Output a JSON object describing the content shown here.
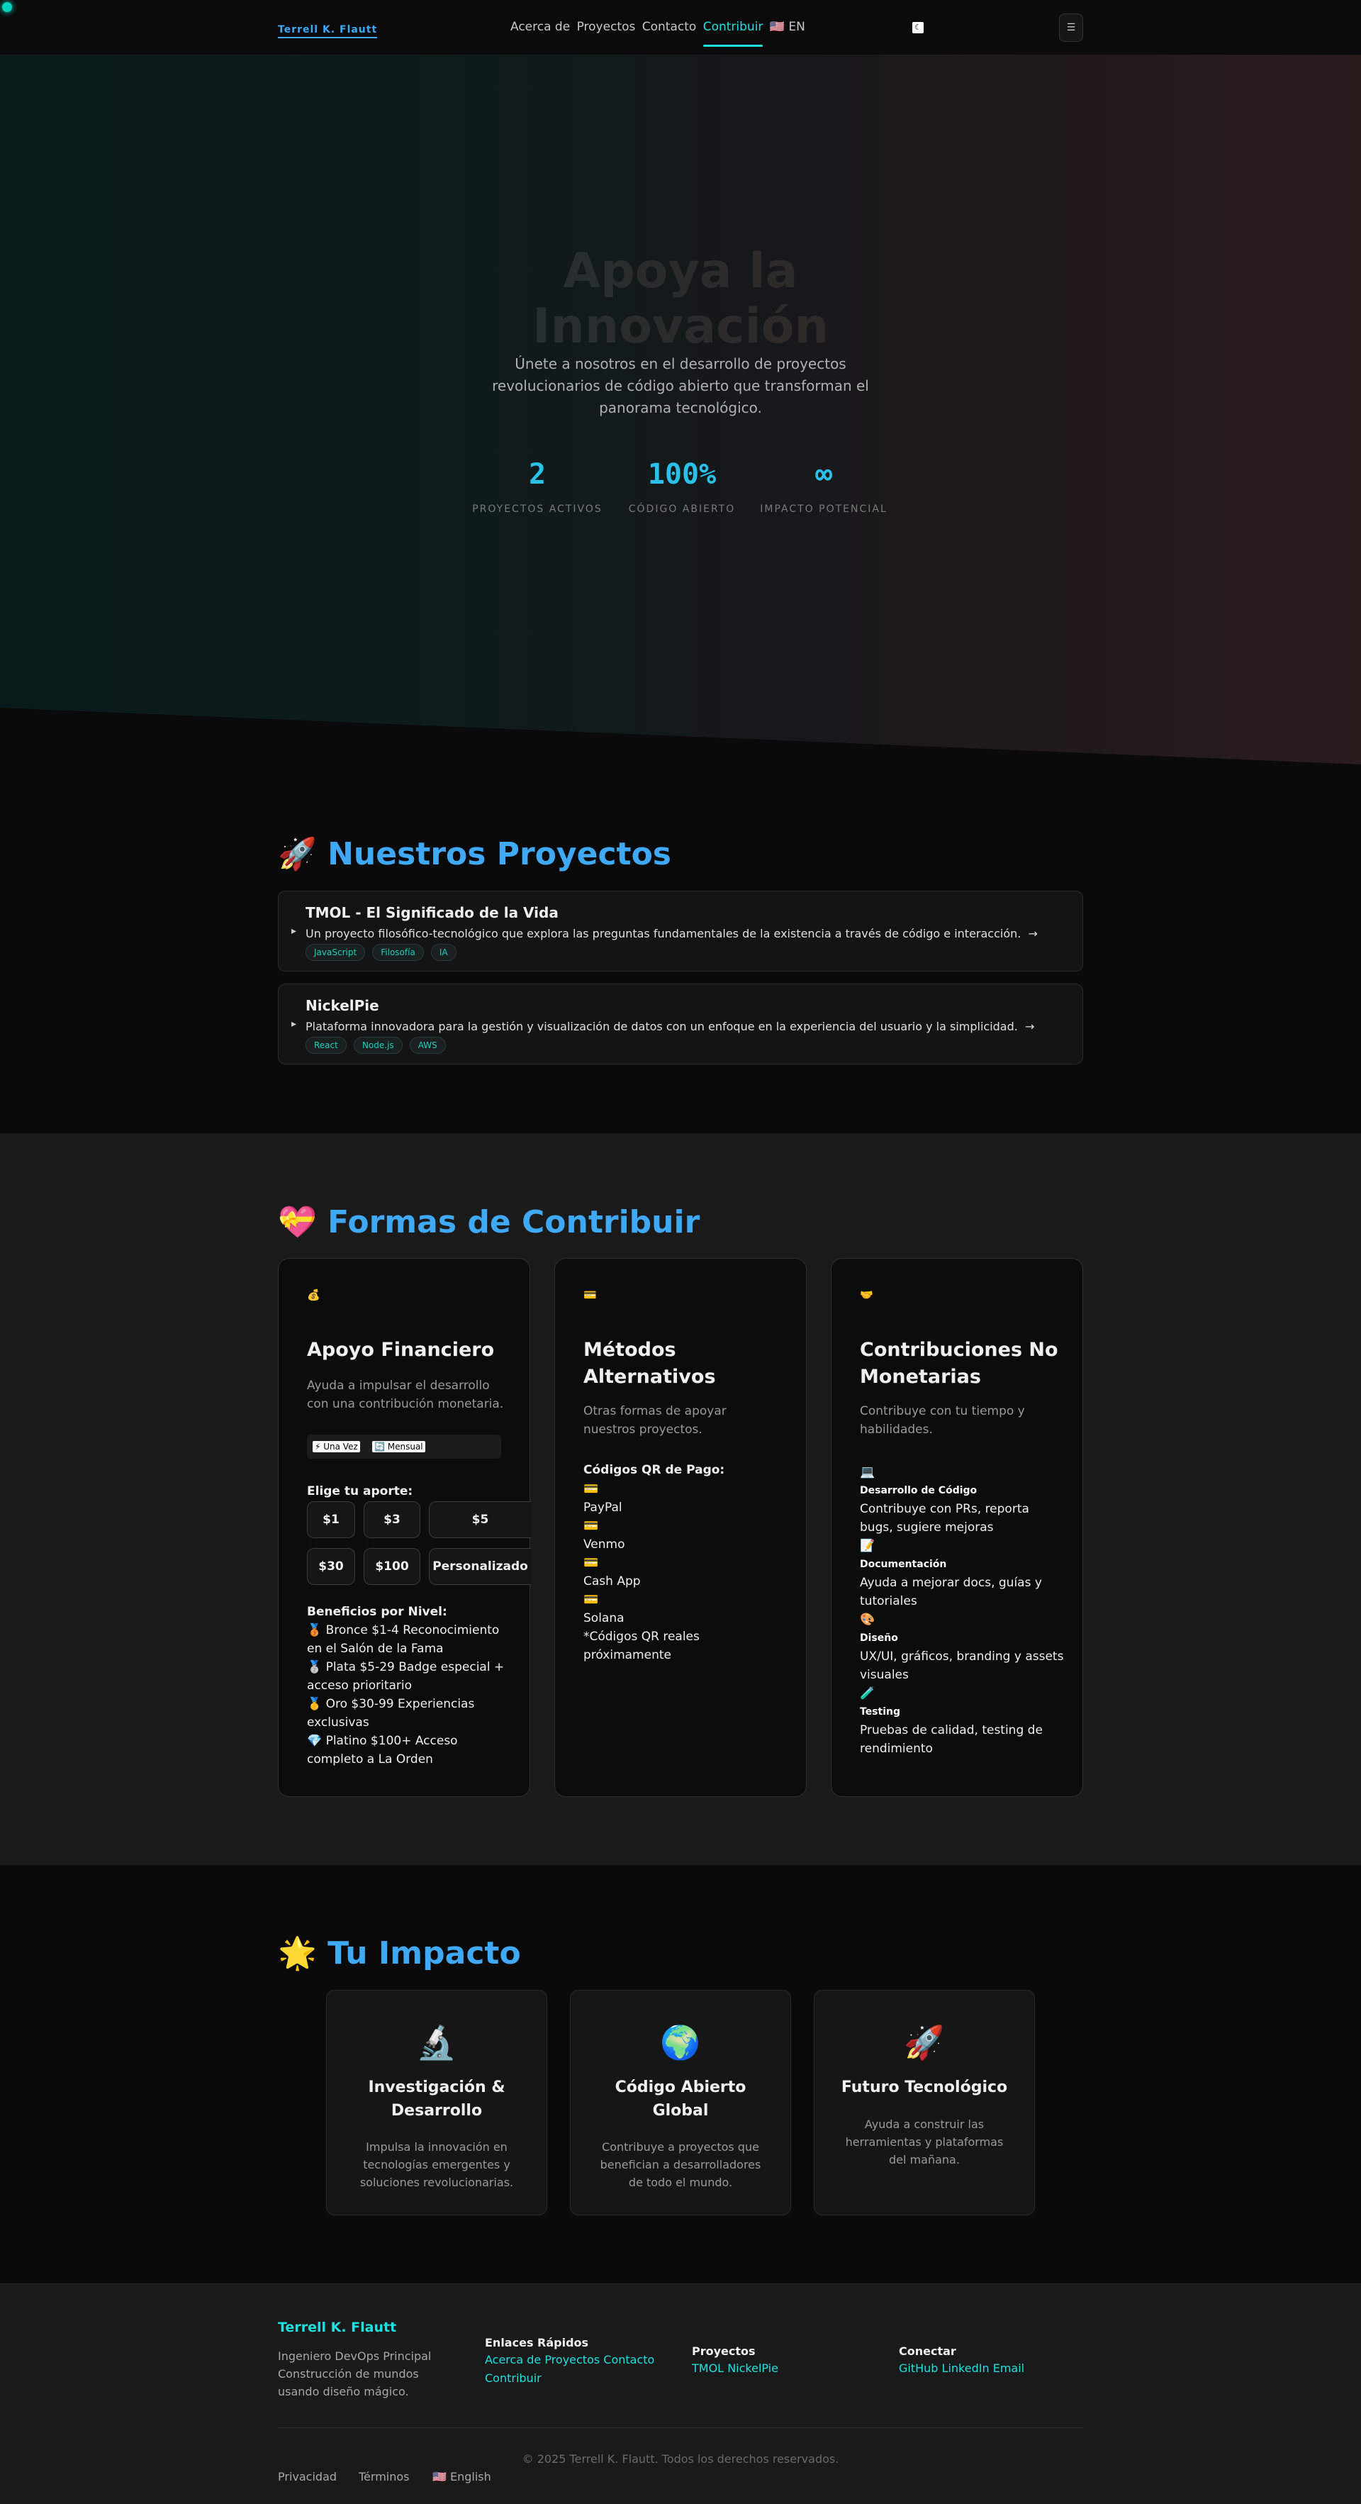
{
  "nav": {
    "brand": "Terrell K. Flautt",
    "links": [
      "Acerca de",
      "Proyectos",
      "Contacto",
      "Contribuir"
    ],
    "lang": "🇺🇸 EN",
    "theme_icon": "moon-icon",
    "menu_icon": "menu-icon"
  },
  "hero": {
    "title_line1": "Apoya la",
    "title_line2": "Innovación",
    "subtitle": "Únete a nosotros en el desarrollo de proyectos revolucionarios de código abierto que transforman el panorama tecnológico.",
    "stats": [
      {
        "value": "2",
        "label": "PROYECTOS ACTIVOS"
      },
      {
        "value": "100%",
        "label": "CÓDIGO ABIERTO"
      },
      {
        "value": "∞",
        "label": "IMPACTO POTENCIAL"
      }
    ]
  },
  "projects": {
    "heading": "🚀 Nuestros Proyectos",
    "items": [
      {
        "title": "TMOL - El Significado de la Vida",
        "description": "Un proyecto filosófico-tecnológico que explora las preguntas fundamentales de la existencia a través de código e interacción.",
        "arrow": "→",
        "tags": [
          "JavaScript",
          "Filosofía",
          "IA"
        ]
      },
      {
        "title": "NickelPie",
        "description": "Plataforma innovadora para la gestión y visualización de datos con un enfoque en la experiencia del usuario y la simplicidad.",
        "arrow": "→",
        "tags": [
          "React",
          "Node.js",
          "AWS"
        ]
      }
    ]
  },
  "contribute": {
    "heading": "💝 Formas de Contribuir",
    "financial": {
      "icon": "💰",
      "title": "Apoyo Financiero",
      "description": "Ayuda a impulsar el desarrollo con una contribución monetaria.",
      "toggle_once": "⚡ Una Vez",
      "toggle_monthly": "🔄 Mensual",
      "choose_label": "Elige tu aporte:",
      "amounts": [
        "$1",
        "$3",
        "$5",
        "$30",
        "$100",
        "Personalizado"
      ],
      "tiers_label": "Beneficios por Nivel:",
      "tiers": [
        "🥉 Bronce $1-4 Reconocimiento en el Salón de la Fama",
        "🥈 Plata $5-29 Badge especial + acceso prioritario",
        "🥇 Oro $30-99 Experiencias exclusivas",
        "💎 Platino $100+ Acceso completo a La Orden"
      ]
    },
    "alternative": {
      "icon": "💳",
      "title": "Métodos Alternativos",
      "description": "Otras formas de apoyar nuestros proyectos.",
      "qr_label": "Códigos QR de Pago:",
      "methods": [
        {
          "icon": "💳",
          "name": "PayPal"
        },
        {
          "icon": "💳",
          "name": "Venmo"
        },
        {
          "icon": "💳",
          "name": "Cash App"
        },
        {
          "icon": "💳",
          "name": "Solana"
        }
      ],
      "note": "*Códigos QR reales próximamente"
    },
    "nonmonetary": {
      "icon": "🤝",
      "title": "Contribuciones No Monetarias",
      "description": "Contribuye con tu tiempo y habilidades.",
      "items": [
        {
          "icon": "💻",
          "title": "Desarrollo de Código",
          "text": "Contribuye con PRs, reporta bugs, sugiere mejoras"
        },
        {
          "icon": "📝",
          "title": "Documentación",
          "text": "Ayuda a mejorar docs, guías y tutoriales"
        },
        {
          "icon": "🎨",
          "title": "Diseño",
          "text": "UX/UI, gráficos, branding y assets visuales"
        },
        {
          "icon": "🧪",
          "title": "Testing",
          "text": "Pruebas de calidad, testing de rendimiento"
        }
      ]
    }
  },
  "impact": {
    "heading": "🌟 Tu Impacto",
    "cards": [
      {
        "icon": "🔬",
        "title": "Investigación & Desarrollo",
        "text": "Impulsa la innovación en tecnologías emergentes y soluciones revolucionarias."
      },
      {
        "icon": "🌍",
        "title": "Código Abierto Global",
        "text": "Contribuye a proyectos que benefician a desarrolladores de todo el mundo."
      },
      {
        "icon": "🚀",
        "title": "Futuro Tecnológico",
        "text": "Ayuda a construir las herramientas y plataformas del mañana."
      }
    ]
  },
  "footer": {
    "brand": "Terrell K. Flautt",
    "description": "Ingeniero DevOps Principal Construcción de mundos usando diseño mágico.",
    "quick_links_title": "Enlaces Rápidos",
    "quick_links": [
      "Acerca de",
      "Proyectos",
      "Contacto",
      "Contribuir"
    ],
    "projects_title": "Proyectos",
    "project_links": [
      "TMOL",
      "NickelPie"
    ],
    "connect_title": "Conectar",
    "connect_links": [
      "GitHub",
      "LinkedIn",
      "Email"
    ],
    "copyright": "© 2025 Terrell K. Flautt. Todos los derechos reservados.",
    "privacy": "Privacidad",
    "terms": "Términos",
    "lang": "🇺🇸 English"
  }
}
